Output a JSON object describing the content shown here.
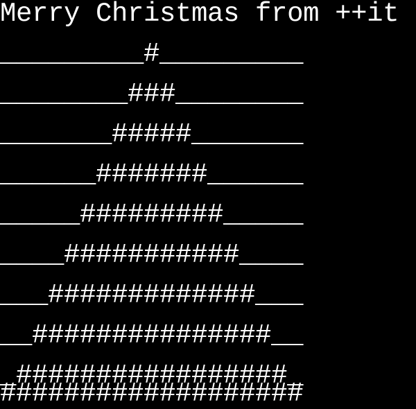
{
  "terminal": {
    "background_color": "#000000",
    "text_color": "#ffffff",
    "lines": [
      "Merry Christmas from ++it",
      "_________#_________",
      "________###________",
      "_______#####_______",
      "______#######______",
      "_____#########_____",
      "____###########____",
      "___#############___",
      "__###############__",
      "_#################_",
      "###################"
    ]
  }
}
